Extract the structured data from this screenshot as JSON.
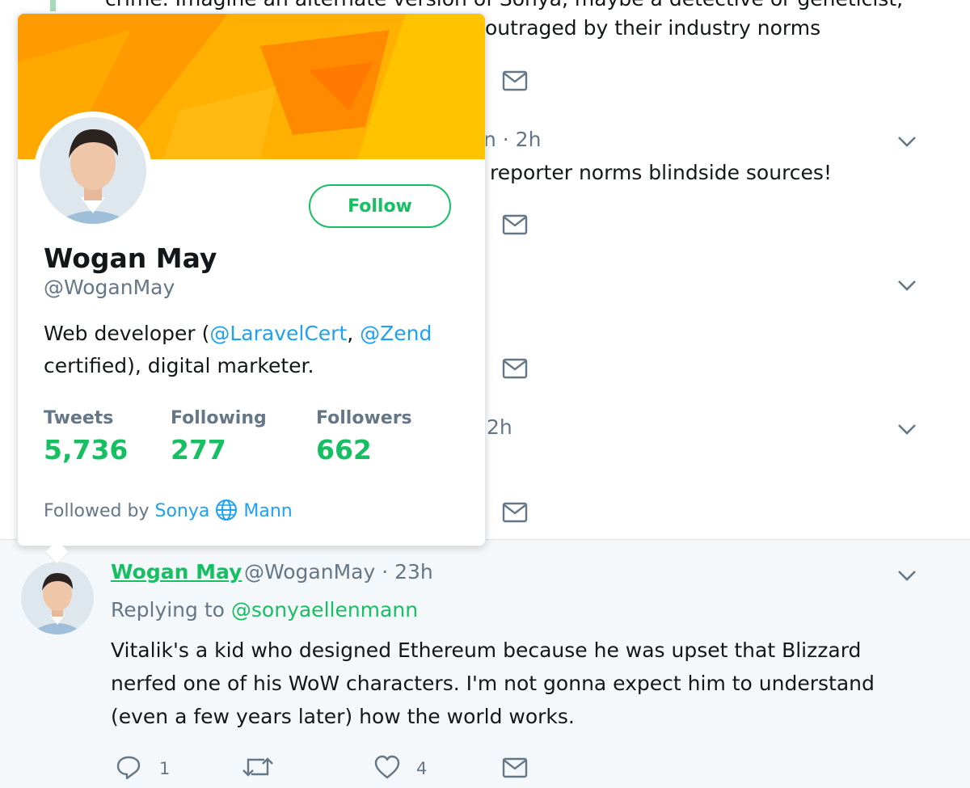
{
  "timeline": {
    "partial_lines": [
      "crime. Imagine an alternate version of Sonya, maybe a detective or geneticist,",
      "outraged by their industry norms",
      "n · 2h",
      "reporter norms blindside sources!",
      "2h"
    ]
  },
  "hovercard": {
    "name": "Wogan May",
    "handle": "@WoganMay",
    "follow_label": "Follow",
    "bio_prefix": "Web developer (",
    "bio_link1": "@LaravelCert",
    "bio_sep": ", ",
    "bio_link2": "@Zend",
    "bio_suffix": "certified), digital marketer.",
    "stats": [
      {
        "label": "Tweets",
        "value": "5,736"
      },
      {
        "label": "Following",
        "value": "277"
      },
      {
        "label": "Followers",
        "value": "662"
      }
    ],
    "followed_by_prefix": "Followed by",
    "followed_by_name1": "Sonya",
    "followed_by_name2": "Mann",
    "colors": {
      "accent": "#17bf63",
      "link": "#1da1f2",
      "banner": "#ffa500"
    }
  },
  "tweet": {
    "name": "Wogan May",
    "meta": "@WoganMay · 23h",
    "replying_prefix": "Replying to",
    "replying_to": "@sonyaellenmann",
    "body": "Vitalik's a kid who designed Ethereum because he was upset that Blizzard nerfed one of his WoW characters. I'm not gonna expect him to understand (even a few years later) how the world works.",
    "reply_count": "1",
    "like_count": "4"
  },
  "icons": [
    "chevron-down-icon",
    "envelope-icon",
    "reply-icon",
    "retweet-icon",
    "heart-icon",
    "globe-icon"
  ]
}
